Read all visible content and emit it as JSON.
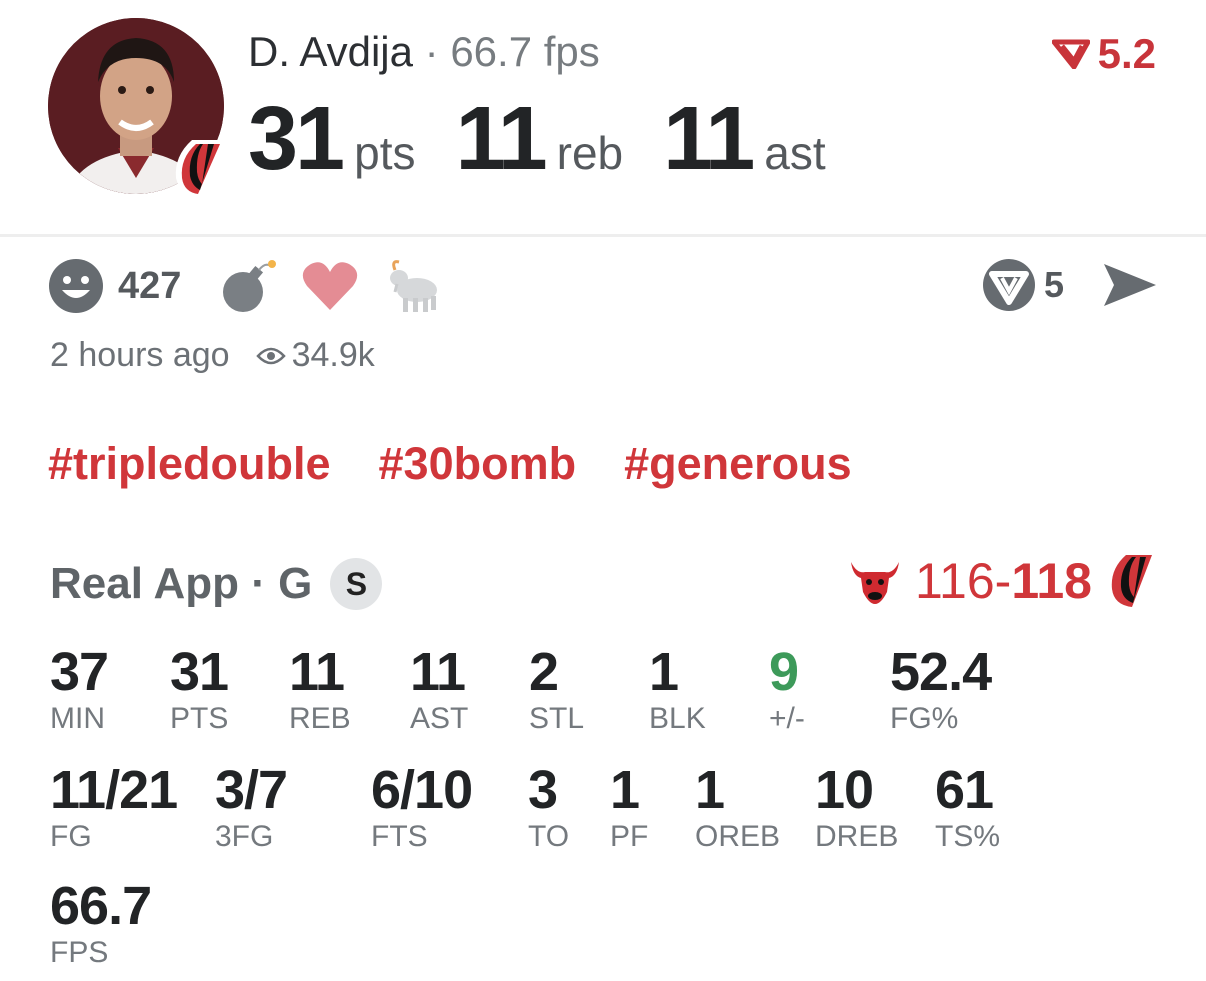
{
  "player": {
    "name": "D. Avdija",
    "separator": " · ",
    "fps_label": "66.7 fps",
    "headline": [
      {
        "value": "31",
        "unit": "pts"
      },
      {
        "value": "11",
        "unit": "reb"
      },
      {
        "value": "11",
        "unit": "ast"
      }
    ],
    "rating": "5.2"
  },
  "reactions": {
    "count": "427",
    "icons": [
      "smiley-icon",
      "bomb-icon",
      "heart-icon",
      "goat-icon"
    ],
    "realapp_count": "5"
  },
  "meta": {
    "time_ago": "2 hours ago",
    "views": "34.9k"
  },
  "hashtags": [
    "#tripledouble",
    "#30bomb",
    "#generous"
  ],
  "game": {
    "source": "Real App · G",
    "badge": "S",
    "away_score": "116",
    "dash": "-",
    "home_score": "118"
  },
  "stats_row1": [
    {
      "value": "37",
      "label": "MIN"
    },
    {
      "value": "31",
      "label": "PTS"
    },
    {
      "value": "11",
      "label": "REB"
    },
    {
      "value": "11",
      "label": "AST"
    },
    {
      "value": "2",
      "label": "STL"
    },
    {
      "value": "1",
      "label": "BLK"
    },
    {
      "value": "9",
      "label": "+/-"
    },
    {
      "value": "52.4",
      "label": "FG%"
    }
  ],
  "stats_row2": [
    {
      "value": "11/21",
      "label": "FG"
    },
    {
      "value": "3/7",
      "label": "3FG"
    },
    {
      "value": "6/10",
      "label": "FTS"
    },
    {
      "value": "3",
      "label": "TO"
    },
    {
      "value": "1",
      "label": "PF"
    },
    {
      "value": "1",
      "label": "OREB"
    },
    {
      "value": "10",
      "label": "DREB"
    },
    {
      "value": "61",
      "label": "TS%"
    }
  ],
  "stats_row3": [
    {
      "value": "66.7",
      "label": "FPS"
    }
  ],
  "colors": {
    "accent_red": "#d0363a",
    "positive_green": "#3d9a5a",
    "text_dark": "#222426",
    "text_muted": "#74797e"
  }
}
